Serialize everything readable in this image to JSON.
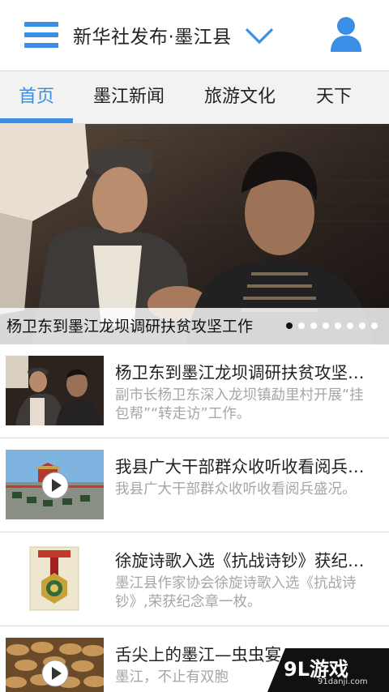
{
  "header": {
    "title": "新华社发布·墨江县",
    "menu_icon": "hamburger-menu-icon",
    "dropdown_icon": "chevron-down-icon",
    "user_icon": "user-profile-icon"
  },
  "tabs": [
    {
      "label": "首页",
      "active": true
    },
    {
      "label": "墨江新闻",
      "active": false
    },
    {
      "label": "旅游文化",
      "active": false
    },
    {
      "label": "天下",
      "active": false
    }
  ],
  "banner": {
    "caption": "杨卫东到墨江龙坝调研扶贫攻坚工作",
    "slide_count": 8,
    "active_slide": 1
  },
  "news": [
    {
      "title": "杨卫东到墨江龙坝调研扶贫攻坚工作",
      "summary": "副市长杨卫东深入龙坝镇勐里村开展“挂包帮”“转走访”工作。",
      "has_video": false
    },
    {
      "title": "我县广大干部群众收听收看阅兵盛况",
      "summary": "我县广大干部群众收听收看阅兵盛况。",
      "has_video": true
    },
    {
      "title": "徐旋诗歌入选《抗战诗钞》获纪念章",
      "summary": "墨江县作家协会徐旋诗歌入选《抗战诗钞》,荣获纪念章一枚。",
      "has_video": false
    },
    {
      "title": "舌尖上的墨江—虫虫宴",
      "summary": "墨江，不止有双胞",
      "has_video": true
    }
  ],
  "watermark": {
    "logo": "9L游戏",
    "domain": "91danji.com"
  },
  "colors": {
    "accent": "#3a8ee6",
    "tab_bar_bg": "#f2f2f2",
    "summary_text": "#a6a6a6"
  }
}
